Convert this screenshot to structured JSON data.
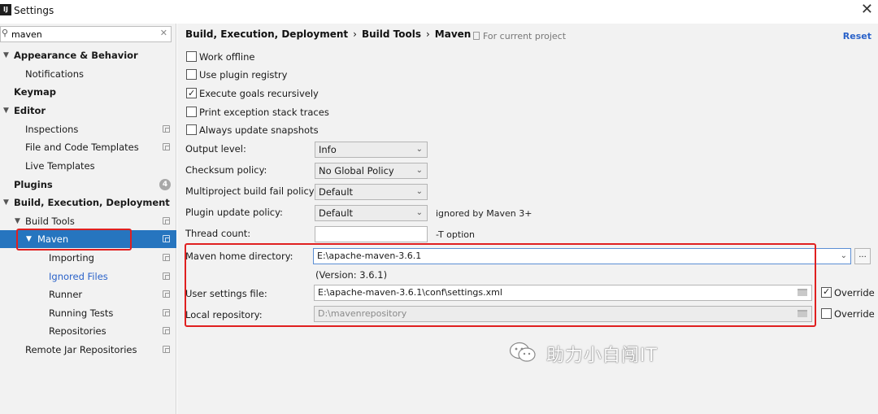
{
  "window": {
    "app_icon": "IJ",
    "title": "Settings",
    "close_icon": "close-icon"
  },
  "search": {
    "value": "maven",
    "icon": "search-icon",
    "clear_icon": "clear-icon"
  },
  "tree": [
    {
      "label": "Appearance & Behavior",
      "bold": true,
      "expanded": true
    },
    {
      "label": "Notifications"
    },
    {
      "label": "Keymap",
      "bold": true
    },
    {
      "label": "Editor",
      "bold": true,
      "expanded": true
    },
    {
      "label": "Inspections"
    },
    {
      "label": "File and Code Templates"
    },
    {
      "label": "Live Templates"
    },
    {
      "label": "Plugins",
      "bold": true,
      "badge": "4"
    },
    {
      "label": "Build, Execution, Deployment",
      "bold": true,
      "expanded": true
    },
    {
      "label": "Build Tools",
      "expanded": true
    },
    {
      "label": "Maven",
      "expanded": true,
      "selected": true
    },
    {
      "label": "Importing"
    },
    {
      "label": "Ignored Files",
      "color": "#2a62c9"
    },
    {
      "label": "Runner"
    },
    {
      "label": "Running Tests"
    },
    {
      "label": "Repositories"
    },
    {
      "label": "Remote Jar Repositories"
    }
  ],
  "breadcrumb": [
    "Build, Execution, Deployment",
    "Build Tools",
    "Maven"
  ],
  "breadcrumb_sep": "›",
  "scope_label": "For current project",
  "reset_label": "Reset",
  "checkboxes": {
    "work_offline": {
      "label": "Work offline",
      "checked": false
    },
    "plugin_registry": {
      "label": "Use plugin registry",
      "checked": false
    },
    "goals_recursively": {
      "label": "Execute goals recursively",
      "checked": true
    },
    "stack_traces": {
      "label": "Print exception stack traces",
      "checked": false
    },
    "update_snapshots": {
      "label": "Always update snapshots",
      "checked": false
    }
  },
  "fields": {
    "output_level": {
      "label": "Output level:",
      "value": "Info"
    },
    "checksum_policy": {
      "label": "Checksum policy:",
      "value": "No Global Policy"
    },
    "multiproject_fail": {
      "label": "Multiproject build fail policy:",
      "value": "Default"
    },
    "plugin_update": {
      "label": "Plugin update policy:",
      "value": "Default",
      "hint": "ignored by Maven 3+"
    },
    "thread_count": {
      "label": "Thread count:",
      "value": "",
      "hint": "-T option"
    },
    "maven_home": {
      "label": "Maven home directory:",
      "value": "E:\\apache-maven-3.6.1",
      "browse": "..."
    },
    "version": "(Version: 3.6.1)",
    "user_settings": {
      "label": "User settings file:",
      "value": "E:\\apache-maven-3.6.1\\conf\\settings.xml",
      "override_label": "Override",
      "override_checked": true
    },
    "local_repo": {
      "label": "Local repository:",
      "value": "D:\\mavenrepository",
      "override_label": "Override",
      "override_checked": false
    }
  },
  "watermark": {
    "text": "助力小白闯IT",
    "icon": "wechat-logo-icon"
  },
  "colors": {
    "selection": "#2675bf",
    "highlight_border": "#e02020",
    "link": "#2a62c9"
  }
}
